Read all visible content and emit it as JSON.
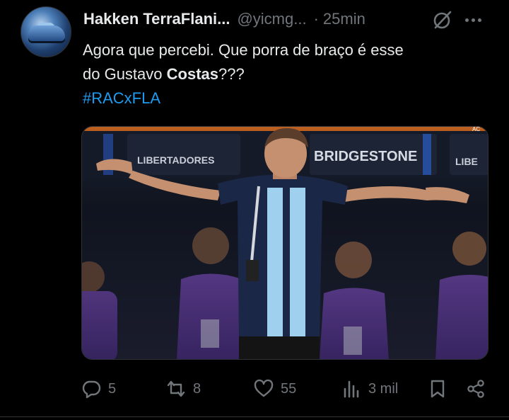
{
  "post": {
    "display_name": "Hakken TerraFlani...",
    "handle": "@yicmg...",
    "separator": "·",
    "time": "25min",
    "text_line1": "Agora que percebi. Que porra de braço é esse",
    "text_line2_prefix": "do Gustavo ",
    "text_line2_bold": "Costas",
    "text_line2_suffix": "???",
    "hashtag": "#RACxFLA"
  },
  "media": {
    "banner_left": "LIBERTADORES",
    "banner_right": "BRIDGESTONE",
    "banner_far_right": "LIBE",
    "corner_tag": "AC"
  },
  "actions": {
    "reply_count": "5",
    "repost_count": "8",
    "like_count": "55",
    "views_count": "3 mil"
  },
  "colors": {
    "background": "#000000",
    "text": "#e7e9ea",
    "secondary": "#71767b",
    "link": "#1d9bf0"
  }
}
